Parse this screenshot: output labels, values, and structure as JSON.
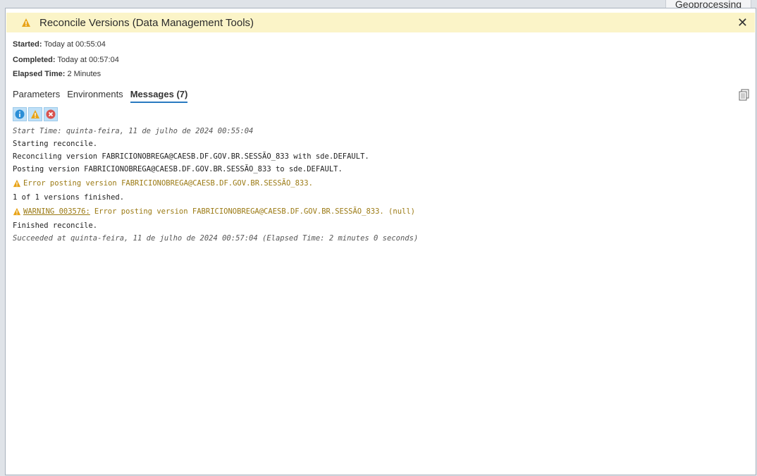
{
  "background_tab": {
    "label": "Geoprocessing"
  },
  "dialog": {
    "title": "Reconcile Versions (Data Management Tools)",
    "close_label": "✕",
    "started_label": "Started:",
    "started_value": "Today at 00:55:04",
    "completed_label": "Completed:",
    "completed_value": "Today at 00:57:04",
    "elapsed_label": "Elapsed Time:",
    "elapsed_value": "2 Minutes",
    "tabs": [
      {
        "label": "Parameters"
      },
      {
        "label": "Environments"
      },
      {
        "label": "Messages (7)"
      }
    ],
    "filters": [
      "info-icon",
      "warning-icon",
      "error-icon"
    ],
    "messages": {
      "start": "Start Time: quinta-feira, 11 de julho de 2024 00:55:04",
      "m1": "Starting reconcile.",
      "m2": "Reconciling version FABRICIONOBREGA@CAESB.DF.GOV.BR.SESSÃO_833 with sde.DEFAULT.",
      "m3": "Posting version FABRICIONOBREGA@CAESB.DF.GOV.BR.SESSÃO_833 to sde.DEFAULT.",
      "w1": "Error posting version FABRICIONOBREGA@CAESB.DF.GOV.BR.SESSÃO_833.",
      "m4": "1 of 1 versions finished.",
      "w2_code": "WARNING 003576:",
      "w2_text": "Error posting version FABRICIONOBREGA@CAESB.DF.GOV.BR.SESSÃO_833. (null)",
      "m5": "Finished reconcile.",
      "end": "Succeeded at quinta-feira, 11 de julho de 2024 00:57:04 (Elapsed Time: 2 minutes 0 seconds)"
    }
  },
  "colors": {
    "header_bg": "#fbf4c8",
    "warning": "#e8a317",
    "warning_text": "#9b7a14",
    "active_tab": "#2a7ac0",
    "error": "#d9534f",
    "info": "#2b8ed6"
  }
}
